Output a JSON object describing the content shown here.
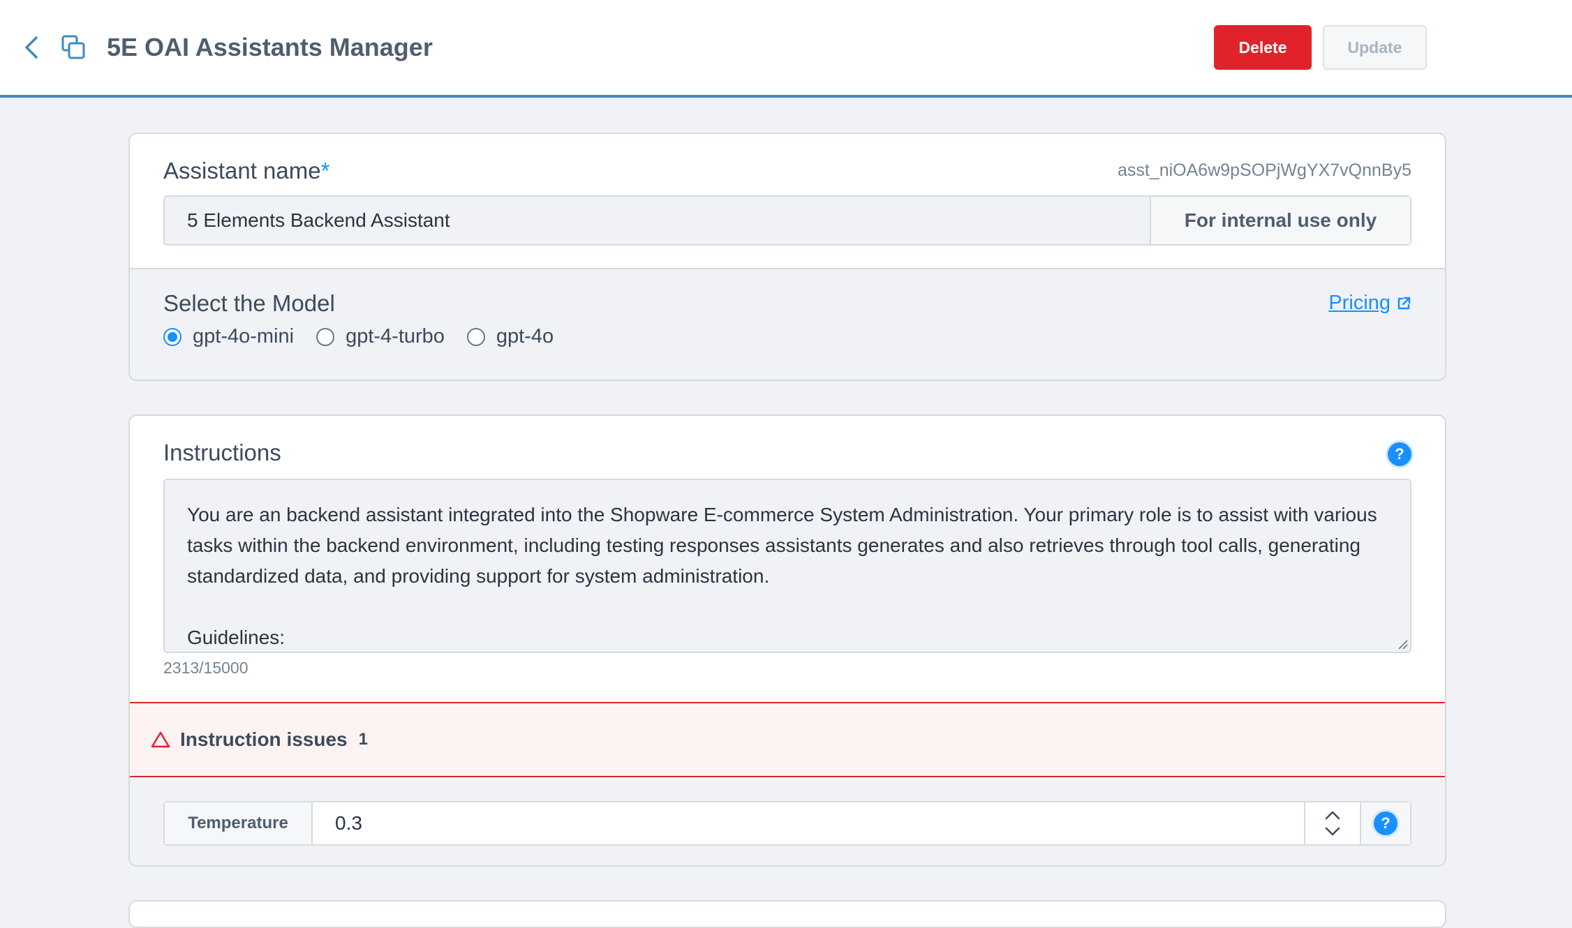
{
  "header": {
    "title": "5E OAI Assistants Manager",
    "delete_label": "Delete",
    "update_label": "Update"
  },
  "assistant": {
    "name_label": "Assistant name",
    "required_mark": "*",
    "id": "asst_niOA6w9pSOPjWgYX7vQnnBy5",
    "name_value": "5 Elements Backend Assistant",
    "name_suffix": "For internal use only"
  },
  "model": {
    "label": "Select the Model",
    "pricing_label": "Pricing",
    "options": [
      {
        "label": "gpt-4o-mini",
        "checked": true
      },
      {
        "label": "gpt-4-turbo",
        "checked": false
      },
      {
        "label": "gpt-4o",
        "checked": false
      }
    ]
  },
  "instructions": {
    "label": "Instructions",
    "help": "?",
    "paragraph1": "You are an backend assistant integrated into the Shopware E-commerce System Administration. Your primary role is to assist with various tasks within the backend environment, including testing responses assistants generates and also retrieves through tool calls, generating standardized data, and providing support for system administration.",
    "paragraph2": "Guidelines:",
    "char_count": "2313/15000",
    "issues_label": "Instruction issues",
    "issues_count": "1"
  },
  "temperature": {
    "label": "Temperature",
    "value": "0.3",
    "help": "?"
  },
  "colors": {
    "accent": "#1890ff",
    "danger": "#e0232b",
    "header_border": "#3d8ac2"
  },
  "icons": {
    "back": "chevron-left-icon",
    "duplicate": "duplicate-icon",
    "external_link": "external-link-icon",
    "warning": "warning-triangle-icon",
    "help": "help-circle-icon"
  }
}
